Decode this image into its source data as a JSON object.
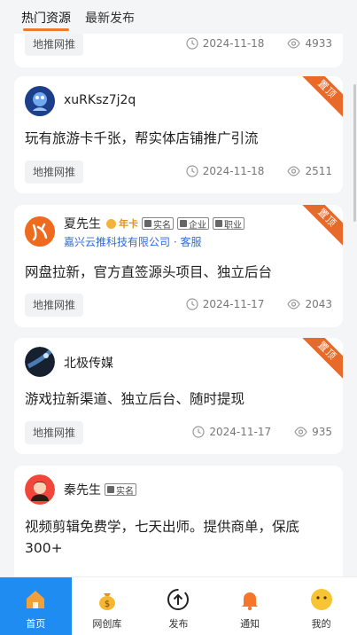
{
  "header": {
    "tabs": [
      {
        "label": "热门资源",
        "active": true
      },
      {
        "label": "最新发布",
        "active": false
      }
    ]
  },
  "posts": [
    {
      "tag": "地推网推",
      "date": "2024-11-18",
      "views": "4933"
    },
    {
      "user": "xuRKsz7j2q",
      "content": "玩有旅游卡千张，帮实体店铺推广引流",
      "tag": "地推网推",
      "date": "2024-11-18",
      "views": "2511",
      "ribbon": "置顶"
    },
    {
      "user": "夏先生",
      "vip": "年卡",
      "badges": [
        "实名",
        "企业",
        "职业"
      ],
      "company": "嘉兴云推科技有限公司 · 客服",
      "content": "网盘拉新，官方直签源头项目、独立后台",
      "tag": "地推网推",
      "date": "2024-11-17",
      "views": "2043",
      "ribbon": "置顶"
    },
    {
      "user": "北极传媒",
      "content": "游戏拉新渠道、独立后台、随时提现",
      "tag": "地推网推",
      "date": "2024-11-17",
      "views": "935",
      "ribbon": "置顶"
    },
    {
      "user": "秦先生",
      "badges": [
        "实名"
      ],
      "content": "视频剪辑免费学，七天出师。提供商单，保底300+"
    }
  ],
  "nav": [
    {
      "label": "首页",
      "icon": "home-icon",
      "active": true
    },
    {
      "label": "网创库",
      "icon": "money-bag-icon",
      "active": false
    },
    {
      "label": "发布",
      "icon": "publish-icon",
      "active": false
    },
    {
      "label": "通知",
      "icon": "bell-icon",
      "active": false
    },
    {
      "label": "我的",
      "icon": "smiley-icon",
      "active": false
    }
  ],
  "colors": {
    "accent": "#f07a2a",
    "nav_active": "#1e8cf0",
    "link": "#2f6bd6"
  }
}
